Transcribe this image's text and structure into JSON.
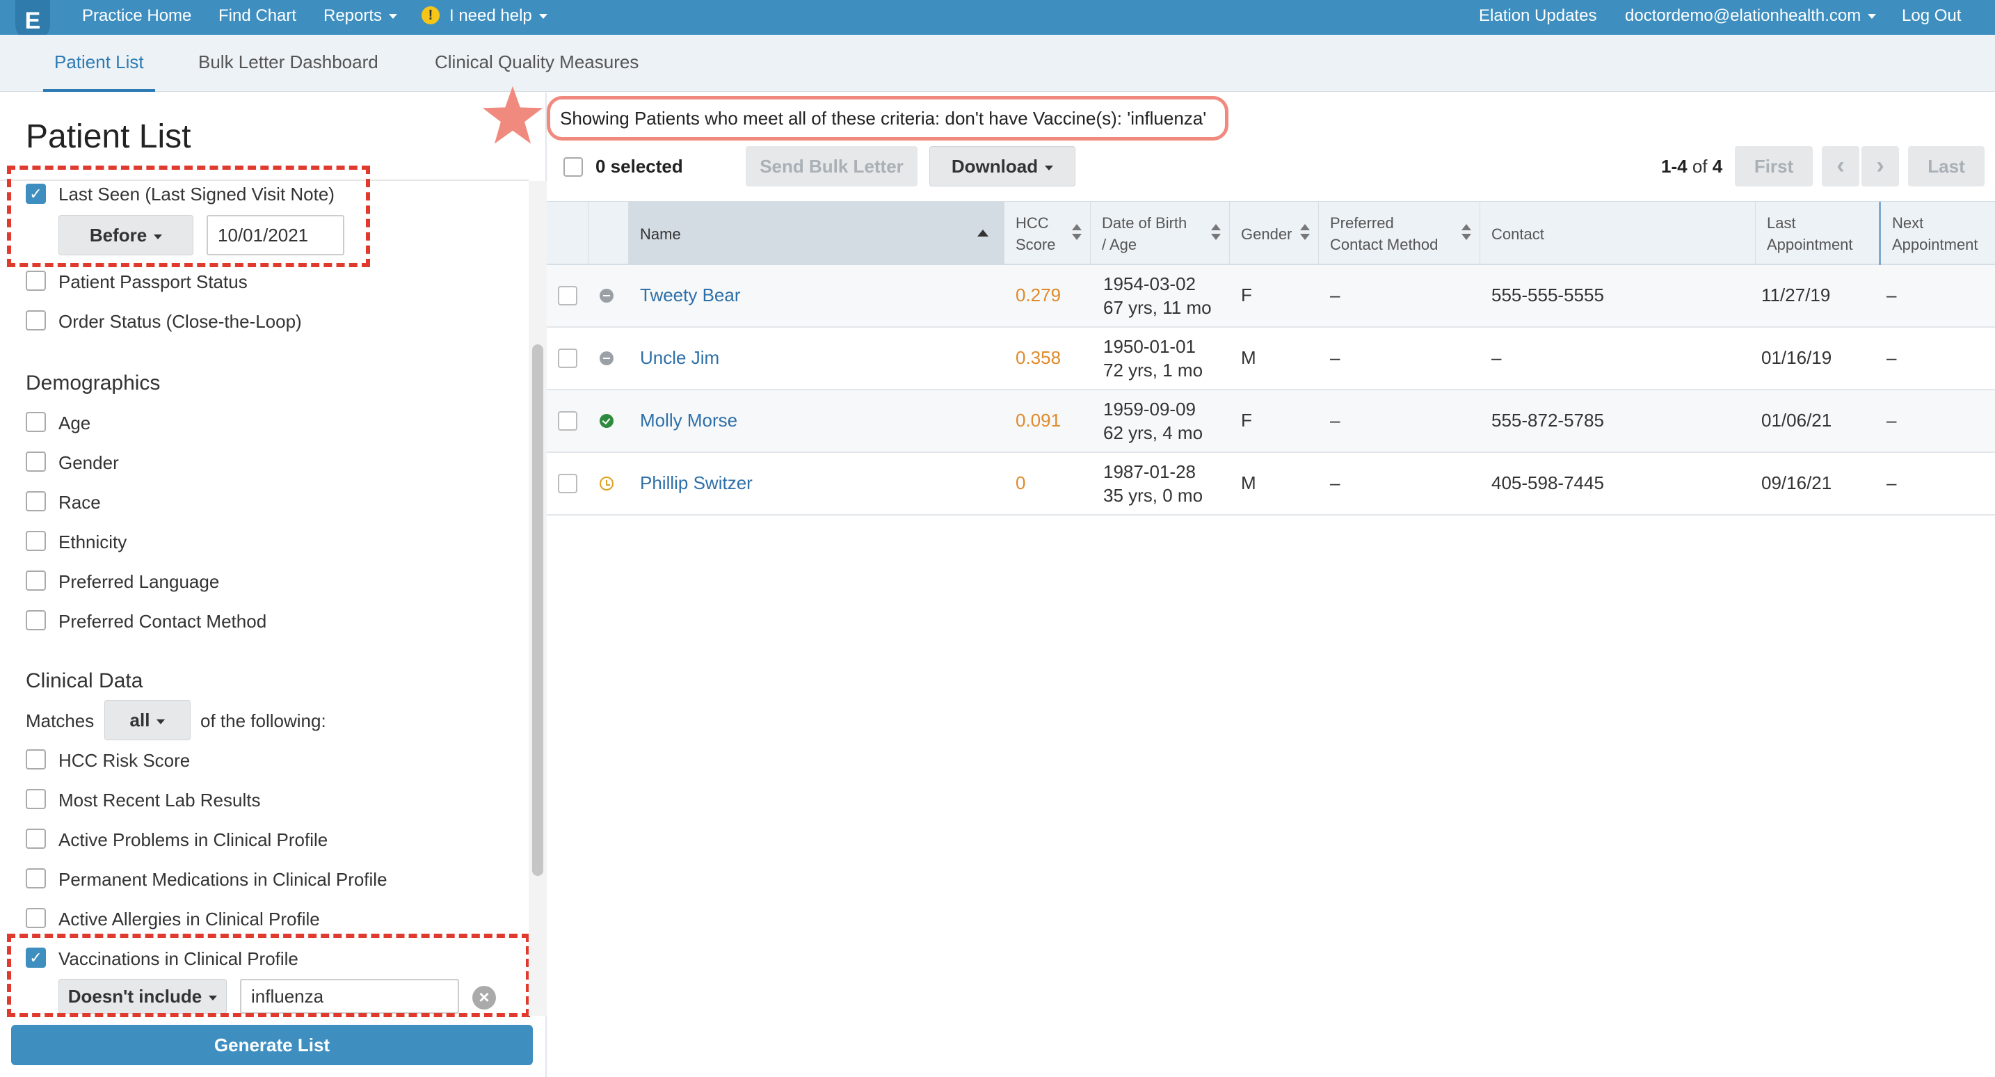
{
  "nav": {
    "logo": "E",
    "practice_home": "Practice Home",
    "find_chart": "Find Chart",
    "reports": "Reports",
    "help_icon": "!",
    "help": "I need help",
    "updates": "Elation Updates",
    "user_email": "doctordemo@elationhealth.com",
    "logout": "Log Out"
  },
  "subtabs": [
    "Patient List",
    "Bulk Letter Dashboard",
    "Clinical Quality Measures"
  ],
  "left": {
    "title": "Patient List",
    "last_seen": {
      "label": "Last Seen (Last Signed Visit Note)",
      "operator": "Before",
      "date": "10/01/2021",
      "checked": true
    },
    "passport_status": "Patient Passport Status",
    "order_status": "Order Status (Close-the-Loop)",
    "demographics": {
      "heading": "Demographics",
      "items": [
        "Age",
        "Gender",
        "Race",
        "Ethnicity",
        "Preferred Language",
        "Preferred Contact Method"
      ]
    },
    "clinical": {
      "heading": "Clinical Data",
      "matches_label": "Matches",
      "matches_value": "all",
      "following_label": "of the following:",
      "items": [
        "HCC Risk Score",
        "Most Recent Lab Results",
        "Active Problems in Clinical Profile",
        "Permanent Medications in Clinical Profile",
        "Active Allergies in Clinical Profile"
      ]
    },
    "vaccinations": {
      "label": "Vaccinations in Clinical Profile",
      "operator": "Doesn't include",
      "value": "influenza",
      "checked": true
    },
    "clear_icon": "×",
    "generate": "Generate List"
  },
  "criteria_text": "Showing Patients who meet all of these criteria: don't have Vaccine(s): 'influenza'",
  "toolbar": {
    "selected": "0 selected",
    "send_bulk": "Send Bulk Letter",
    "download": "Download",
    "range": "1-4",
    "of_label": "of",
    "total": "4",
    "first": "First",
    "prev": "‹",
    "next": "›",
    "last": "Last"
  },
  "table": {
    "headers": {
      "name": "Name",
      "hcc_1": "HCC",
      "hcc_2": "Score",
      "dob_1": "Date of Birth",
      "dob_2": "/ Age",
      "gender": "Gender",
      "pcm_1": "Preferred",
      "pcm_2": "Contact Method",
      "contact": "Contact",
      "last_1": "Last",
      "last_2": "Appointment",
      "next_1": "Next",
      "next_2": "Appointment"
    },
    "rows": [
      {
        "name": "Tweety Bear",
        "hcc": "0.279",
        "dob": "1954-03-02",
        "age": "67 yrs, 11 mo",
        "gender": "F",
        "pcm": "–",
        "contact": "555-555-5555",
        "last": "11/27/19",
        "next": "–"
      },
      {
        "name": "Uncle Jim",
        "hcc": "0.358",
        "dob": "1950-01-01",
        "age": "72 yrs, 1 mo",
        "gender": "M",
        "pcm": "–",
        "contact": "–",
        "last": "01/16/19",
        "next": "–"
      },
      {
        "name": "Molly Morse",
        "hcc": "0.091",
        "dob": "1959-09-09",
        "age": "62 yrs, 4 mo",
        "gender": "F",
        "pcm": "–",
        "contact": "555-872-5785",
        "last": "01/06/21",
        "next": "–"
      },
      {
        "name": "Phillip Switzer",
        "hcc": "0",
        "dob": "1987-01-28",
        "age": "35 yrs, 0 mo",
        "gender": "M",
        "pcm": "–",
        "contact": "405-598-7445",
        "last": "09/16/21",
        "next": "–"
      }
    ]
  },
  "colors": {
    "brand": "#3e8fc0",
    "highlight_red": "#e03a2e",
    "criteria_outline": "#f08a7e",
    "hcc_orange": "#e08a2a"
  }
}
